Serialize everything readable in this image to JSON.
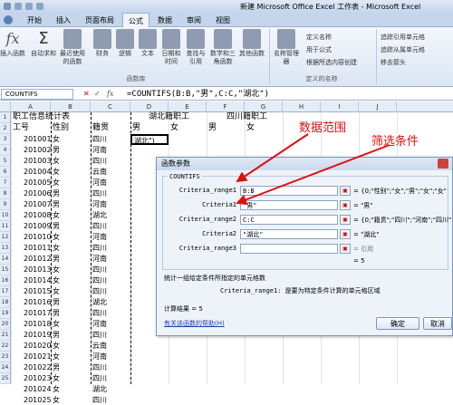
{
  "window": {
    "title": "新建 Microsoft Office Excel 工作表 - Microsoft Excel"
  },
  "tabs": [
    "开始",
    "插入",
    "页面布局",
    "公式",
    "数据",
    "审阅",
    "视图"
  ],
  "active_tab": "公式",
  "ribbon": {
    "big_buttons": [
      {
        "label": "插入函数",
        "icon": "fx-icon"
      },
      {
        "label": "自动求和",
        "icon": "sigma-icon"
      },
      {
        "label": "最近使用的函数",
        "icon": "book-icon"
      },
      {
        "label": "财务",
        "icon": "book-icon"
      },
      {
        "label": "逻辑",
        "icon": "book-icon"
      },
      {
        "label": "文本",
        "icon": "book-icon"
      },
      {
        "label": "日期和时间",
        "icon": "book-icon"
      },
      {
        "label": "查找与引用",
        "icon": "book-icon"
      },
      {
        "label": "数学和三角函数",
        "icon": "book-icon"
      },
      {
        "label": "其他函数",
        "icon": "book-icon"
      },
      {
        "label": "名称管理器",
        "icon": "book-icon"
      }
    ],
    "small_buttons": [
      "定义名称",
      "用于公式",
      "根据所选内容创建",
      "追踪引用单元格",
      "追踪从属单元格",
      "移去箭头"
    ],
    "groups": [
      "函数库",
      "定义的名称"
    ]
  },
  "formula_bar": {
    "name_box": "COUNTIFS",
    "fx": "fx",
    "formula": "=COUNTIFS(B:B,\"男\",C:C,\"湖北\")"
  },
  "columns": [
    "A",
    "B",
    "C",
    "D",
    "E",
    "F",
    "G",
    "H",
    "I",
    "J"
  ],
  "row_numbers": [
    "1",
    "2",
    "3",
    "4",
    "5",
    "6",
    "7",
    "8",
    "9",
    "10",
    "11",
    "12",
    "13",
    "14",
    "15",
    "16",
    "17",
    "18",
    "19",
    "20",
    "21",
    "22",
    "23",
    "24",
    "25"
  ],
  "sheet": {
    "A1": "职工信息统计表",
    "A2": "工号",
    "B2": "性别",
    "C2": "籍贯",
    "D1": "湖北籍职工",
    "F1": "四川籍职工",
    "D2": "男",
    "E2": "女",
    "F2": "男",
    "G2": "女",
    "D3": "湖北\")",
    "ids": [
      "201001",
      "201002",
      "201003",
      "201004",
      "201005",
      "201006",
      "201007",
      "201008",
      "201009",
      "201010",
      "201011",
      "201012",
      "201013",
      "201014",
      "201015",
      "201016",
      "201017",
      "201018",
      "201019",
      "201020",
      "201021",
      "201022",
      "201023",
      "201024",
      "201025"
    ],
    "genders": [
      "女",
      "男",
      "女",
      "女",
      "女",
      "男",
      "男",
      "女",
      "男",
      "女",
      "女",
      "男",
      "女",
      "女",
      "女",
      "男",
      "男",
      "女",
      "男",
      "女",
      "女",
      "男",
      "女",
      "女",
      "女"
    ],
    "origins": [
      "四川",
      "河南",
      "四川",
      "云南",
      "河南",
      "四川",
      "河南",
      "湖北",
      "四川",
      "河南",
      "四川",
      "河南",
      "四川",
      "四川",
      "四川",
      "湖北",
      "四川",
      "河南",
      "四川",
      "云南",
      "河南",
      "四川",
      "四川",
      "湖北",
      "四川"
    ]
  },
  "annotations": {
    "range": "数据范围",
    "criteria": "筛选条件"
  },
  "dialog": {
    "title": "函数参数",
    "function": "COUNTIFS",
    "args": [
      {
        "label": "Criteria_range1",
        "value": "B:B",
        "result": "= {0;\"性别\";\"女\";\"男\";\"女\";\"女\""
      },
      {
        "label": "Criteria1",
        "value": "\"男\"",
        "result": "= \"男\""
      },
      {
        "label": "Criteria_range2",
        "value": "C:C",
        "result": "= {0;\"籍贯\";\"四川\";\"河南\";\"四川\""
      },
      {
        "label": "Criteria2",
        "value": "\"湖北\"",
        "result": "= \"湖北\""
      },
      {
        "label": "Criteria_range3",
        "value": "",
        "result": "= 引用"
      }
    ],
    "equals_result": "= 5",
    "description": "统计一组给定条件所指定的单元格数",
    "arg_help": "Criteria_range1:  是要为特定条件计算的单元格区域",
    "calc_result": "计算结果 = 5",
    "help_link": "有关该函数的帮助(H)",
    "ok": "确定",
    "cancel": "取消"
  }
}
